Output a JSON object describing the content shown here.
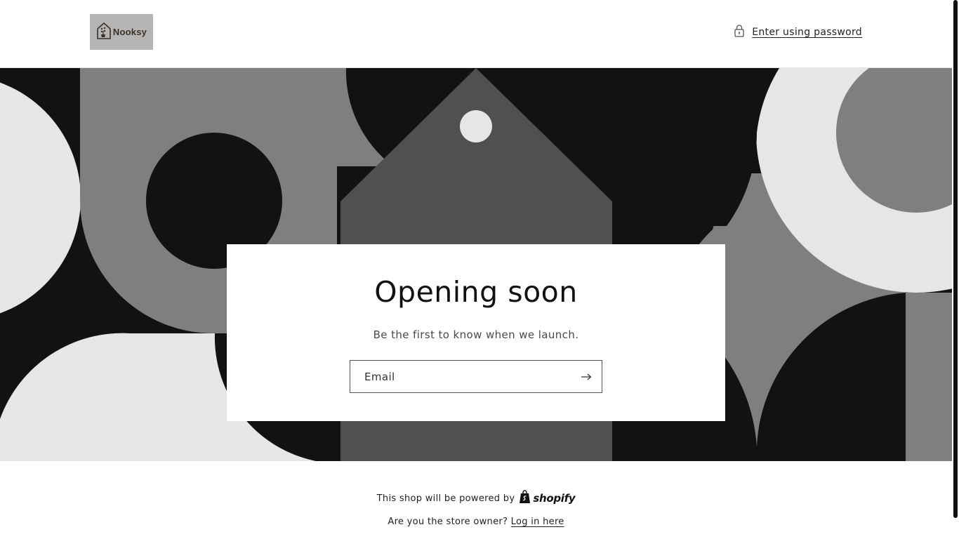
{
  "header": {
    "logo_text": "Nooksy",
    "password_link_label": "Enter using password",
    "icons": {
      "logo_mark": "house-plant-icon",
      "lock": "lock-icon"
    }
  },
  "newsletter": {
    "heading": "Opening soon",
    "subheading": "Be the first to know when we launch.",
    "email_placeholder": "Email",
    "email_value": "",
    "submit_icon": "arrow-right-icon"
  },
  "footer": {
    "powered_by_text": "This shop will be powered by",
    "shopify_brand": "shopify",
    "owner_question": "Are you the store owner?",
    "login_link": "Log in here"
  },
  "colors": {
    "background": "#ffffff",
    "text": "#121212",
    "banner_black": "#121212",
    "banner_gray": "#7f7f7f",
    "banner_dark_gray": "#505050",
    "banner_light_gray": "#e6e6e6",
    "logo_background": "#b5b5b5"
  }
}
